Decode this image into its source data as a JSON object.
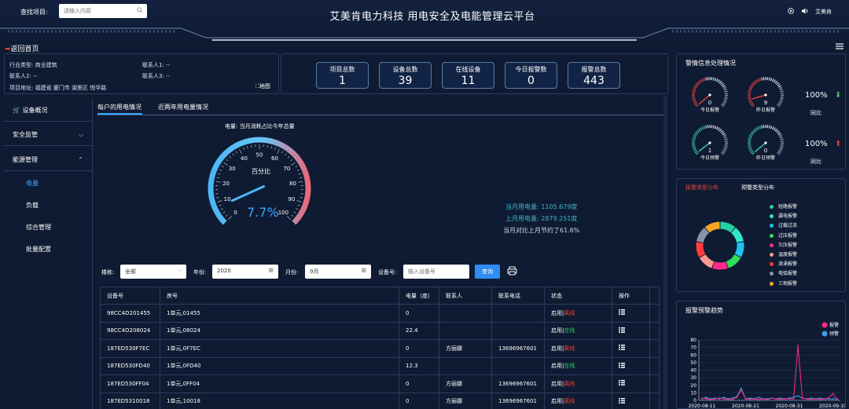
{
  "header": {
    "search_label": "查找项目:",
    "search_placeholder": "请输入内容",
    "title": "艾美肯电力科技 用电安全及电能管理云平台",
    "username": "艾美肯"
  },
  "back_label": "返回首页",
  "info": {
    "industry": "行业类型: 商业建筑",
    "contact1": "联系人1: --",
    "contact2": "联系人2: --",
    "contact3": "联系人3: --",
    "address": "项目地址: 福建省 厦门市 湖里区 悦华路",
    "map": "地图"
  },
  "stats": [
    {
      "label": "项目总数",
      "value": "1"
    },
    {
      "label": "设备总数",
      "value": "39"
    },
    {
      "label": "在线设备",
      "value": "11"
    },
    {
      "label": "今日报警数",
      "value": "0"
    },
    {
      "label": "报警总数",
      "value": "443"
    }
  ],
  "sidebar": {
    "items": [
      {
        "label": "设备概况"
      },
      {
        "label": "安全监管"
      },
      {
        "label": "能源管理"
      },
      {
        "label": "电量"
      },
      {
        "label": "负载"
      },
      {
        "label": "综合管理"
      },
      {
        "label": "批量配置"
      }
    ]
  },
  "tabs": [
    "每户的用电情况",
    "近两年用电量情况"
  ],
  "gauge": {
    "title": "电量: 当月消耗占比今年总量",
    "center_label": "百分比",
    "value_text": "7.7%",
    "value": 7.7,
    "min": 0,
    "max": 100,
    "ticks": [
      "0",
      "10",
      "20",
      "30",
      "40",
      "50",
      "60",
      "70",
      "80",
      "90",
      "100"
    ]
  },
  "usage": {
    "current": "当月用电量: 1105.679度",
    "last": "上月用电量: 2879.251度",
    "compare": "当月对比上月节约了61.6%"
  },
  "filters": {
    "building_label": "楼栋:",
    "building_value": "全部",
    "year_label": "年份:",
    "year_value": "2020",
    "month_label": "月份:",
    "month_value": "9月",
    "device_label": "设备号:",
    "device_placeholder": "输入设备号",
    "query_label": "查询"
  },
  "table": {
    "headers": [
      "设备号",
      "房号",
      "电量（度）",
      "联系人",
      "联系电话",
      "状态",
      "操作"
    ],
    "rows": [
      {
        "device": "98CC4D201455",
        "room": "1单元,01455",
        "power": "0",
        "contact": "",
        "phone": "",
        "state_prefix": "启用|",
        "state": "离线",
        "online": false
      },
      {
        "device": "98CC4D208024",
        "room": "1单元,08024",
        "power": "22.4",
        "contact": "",
        "phone": "",
        "state_prefix": "启用|",
        "state": "在线",
        "online": true
      },
      {
        "device": "187ED530F7EC",
        "room": "1单元,0F7EC",
        "power": "0",
        "contact": "方丽娜",
        "phone": "13696967601",
        "state_prefix": "启用|",
        "state": "离线",
        "online": false
      },
      {
        "device": "187ED530FD40",
        "room": "1单元,0FD40",
        "power": "12.3",
        "contact": "",
        "phone": "",
        "state_prefix": "启用|",
        "state": "在线",
        "online": true
      },
      {
        "device": "187ED530FF04",
        "room": "1单元,0FF04",
        "power": "0",
        "contact": "方丽娜",
        "phone": "13696967601",
        "state_prefix": "启用|",
        "state": "离线",
        "online": false
      },
      {
        "device": "187ED5310018",
        "room": "1单元,10018",
        "power": "0",
        "contact": "方丽娜",
        "phone": "13696967601",
        "state_prefix": "启用|",
        "state": "离线",
        "online": false
      }
    ]
  },
  "alarm_panel": {
    "title": "警情信息处理情况",
    "gauges": [
      {
        "value": "0",
        "label": "今日报警",
        "level": 0,
        "color": "#e0433a"
      },
      {
        "value": "9",
        "label": "昨日报警",
        "level": 0.09,
        "color": "#e0433a"
      },
      {
        "value": "1",
        "label": "今日预警",
        "level": 0.01,
        "color": "#3fc3a8"
      },
      {
        "value": "0",
        "label": "昨日预警",
        "level": 0,
        "color": "#3fc3a8"
      }
    ],
    "pct_alarm": "100%",
    "pct_warn": "100%",
    "ratio_label": "同比",
    "down_color": "#3fc36b",
    "up_color": "#e0433a"
  },
  "type_panel": {
    "tab_alarm": "报警类型分布",
    "tab_warn": "预警类型分布",
    "legend": [
      {
        "name": "短路报警",
        "color": "#22d3a2"
      },
      {
        "name": "漏电报警",
        "color": "#33e6c9"
      },
      {
        "name": "过载过流",
        "color": "#1ec1f0"
      },
      {
        "name": "过压报警",
        "color": "#2fe057"
      },
      {
        "name": "欠压报警",
        "color": "#ff2a8c"
      },
      {
        "name": "温度报警",
        "color": "#f79a8e"
      },
      {
        "name": "浪涌报警",
        "color": "#ff3b3b"
      },
      {
        "name": "电弧报警",
        "color": "#8c93a8"
      },
      {
        "name": "三相报警",
        "color": "#f5a623"
      }
    ]
  },
  "chart_data": {
    "type": "line",
    "title": "报警预警趋势",
    "x": [
      "2020-08-11",
      "2020-08-21",
      "2020-08-31",
      "2020-09-10"
    ],
    "yticks": [
      "0",
      "10",
      "20",
      "30",
      "40",
      "50",
      "60",
      "70",
      "80"
    ],
    "ylim": [
      0,
      80
    ],
    "legend_position": "top-right",
    "series": [
      {
        "name": "报警",
        "color": "#ff2a8c",
        "values": [
          3,
          2,
          1,
          2,
          3,
          2,
          1,
          1,
          4,
          14,
          2,
          1,
          2,
          1,
          2,
          1,
          3,
          2,
          1,
          2,
          2,
          2,
          73,
          3,
          2,
          1,
          2,
          1,
          2,
          3,
          9,
          1
        ]
      },
      {
        "name": "预警",
        "color": "#3aa0e8",
        "values": [
          2,
          4,
          2,
          3,
          2,
          4,
          2,
          3,
          5,
          16,
          2,
          3,
          2,
          4,
          2,
          2,
          3,
          2,
          3,
          2,
          3,
          4,
          6,
          3,
          2,
          3,
          2,
          3,
          2,
          2,
          2,
          2
        ]
      }
    ]
  }
}
